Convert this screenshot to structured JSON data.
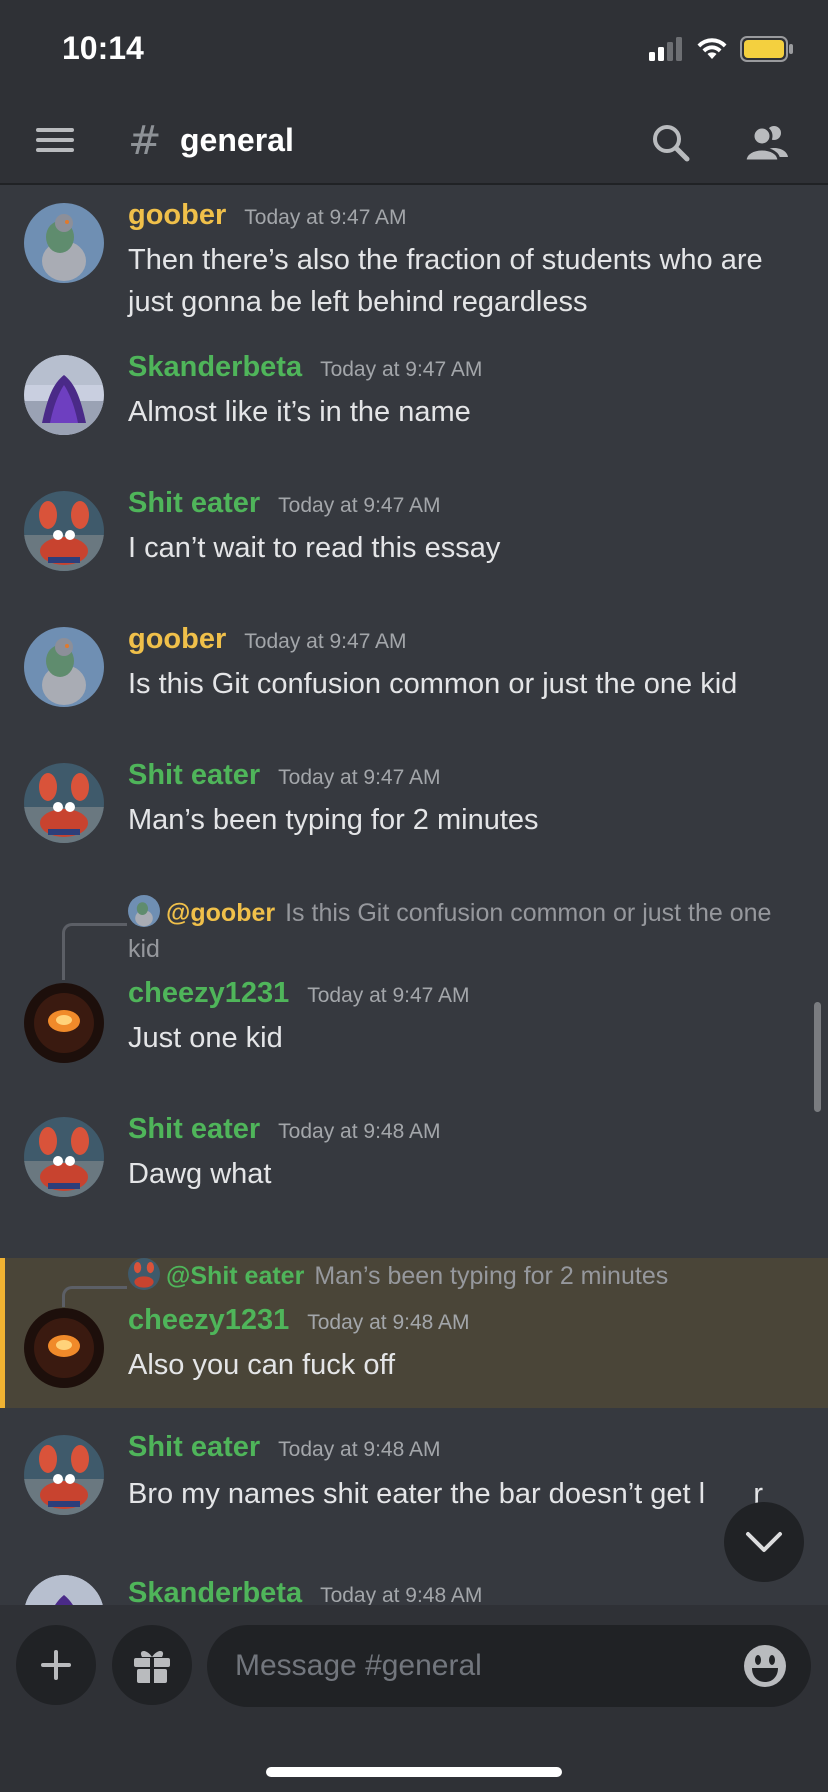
{
  "status_bar": {
    "time": "10:14"
  },
  "header": {
    "menu_icon": "hamburger-icon",
    "channel_icon": "#",
    "channel_name": "general",
    "search_icon": "search-icon",
    "members_icon": "members-icon"
  },
  "colors": {
    "goober": "#f0c04a",
    "green_user": "#4fb55a",
    "highlight_bg": "#4a4538",
    "highlight_bar": "#f0b232"
  },
  "messages": [
    {
      "author": "goober",
      "time": "Today at 9:47 AM",
      "text": "Then there’s also the fraction of students who are just gonna be left behind regardless"
    },
    {
      "author": "Skanderbeta",
      "time": "Today at 9:47 AM",
      "text": "Almost like it’s in the name"
    },
    {
      "author": "Shit eater",
      "time": "Today at 9:47 AM",
      "text": "I can’t wait to read this essay"
    },
    {
      "author": "goober",
      "time": "Today at 9:47 AM",
      "text": "Is this Git confusion common or just the one kid"
    },
    {
      "author": "Shit eater",
      "time": "Today at 9:47 AM",
      "text": "Man’s been typing for 2 minutes"
    },
    {
      "author": "cheezy1231",
      "time": "Today at 9:47 AM",
      "text": "Just one kid",
      "reply_to": {
        "mention": "@goober",
        "text": "Is this Git confusion common or just the one kid"
      }
    },
    {
      "author": "Shit eater",
      "time": "Today at 9:48 AM",
      "text": "Dawg what"
    },
    {
      "author": "cheezy1231",
      "time": "Today at 9:48 AM",
      "text": "Also you can fuck off",
      "reply_to": {
        "mention": "@Shit eater",
        "text": "Man’s been typing for 2 minutes"
      }
    },
    {
      "author": "Shit eater",
      "time": "Today at 9:48 AM",
      "text": "Bro my names shit eater the bar doesn’t get l      r"
    },
    {
      "author": "Skanderbeta",
      "time": "Today at 9:48 AM",
      "text": ""
    }
  ],
  "composer": {
    "add_icon": "plus-icon",
    "gift_icon": "gift-icon",
    "placeholder": "Message #general",
    "emoji_icon": "emoji-icon"
  },
  "jump_to_bottom_icon": "chevron-down-icon"
}
